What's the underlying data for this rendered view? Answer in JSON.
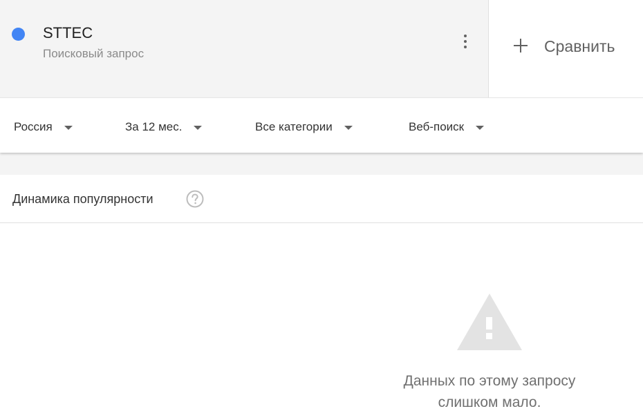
{
  "term": {
    "name": "STTEC",
    "type": "Поисковый запрос",
    "color": "#4285f4",
    "menu_icon": "more-vert-icon"
  },
  "compare": {
    "label": "Сравнить",
    "icon": "plus-icon"
  },
  "filters": [
    {
      "label": "Россия"
    },
    {
      "label": "За 12 мес."
    },
    {
      "label": "Все категории"
    },
    {
      "label": "Веб-поиск"
    }
  ],
  "widget": {
    "title": "Динамика популярности",
    "help_icon": "help-circle-icon",
    "warning_icon": "warning-triangle-icon",
    "message_line1": "Данных по этому запросу",
    "message_line2": "слишком мало."
  },
  "colors": {
    "accent": "#4285f4",
    "header_bg": "#f4f4f4",
    "icon_gray": "#616161",
    "warning_gray": "#e3e3e3"
  }
}
